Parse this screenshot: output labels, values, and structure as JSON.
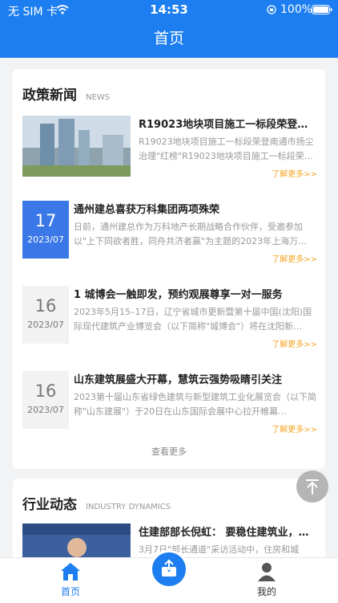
{
  "status_bar": {
    "carrier": "无 SIM 卡",
    "time": "14:53",
    "battery": "100%"
  },
  "header": {
    "title": "首页"
  },
  "policy_news": {
    "title": "政策新闻",
    "subtitle": "NEWS",
    "more_label": "了解更多>>",
    "view_more": "查看更多",
    "items": [
      {
        "title": "R19023地块项目施工一标段荣登南…",
        "desc": "R19023地块项目施工一标段荣登南通市扬尘治理\"红榜\"R19023地块项目施工一标段荣…"
      },
      {
        "day": "17",
        "month": "2023/07",
        "title": "通州建总喜获万科集团两项殊荣",
        "desc": "日前，通州建总作为万科地产长期战略合作伙伴，受邀参加以\"上下同欲者胜，同舟共济者赢\"为主题的2023年上海万…"
      },
      {
        "day": "16",
        "month": "2023/07",
        "title": "1 城博会一触即发，预约观展尊享一对一服务",
        "desc": "2023年5月15–17日，辽宁省城市更新暨第十届中国(沈阳)国际现代建筑产业博览会（以下简称\"城博会\"）将在沈阳新…"
      },
      {
        "day": "16",
        "month": "2023/07",
        "title": "山东建筑展盛大开幕，慧筑云强势吸睛引关注",
        "desc": "2023第十届山东省绿色建筑与新型建筑工业化展览会（以下简称\"山东建展\"）于20日在山东国际会展中心拉开帷幕…"
      }
    ]
  },
  "industry": {
    "title": "行业动态",
    "subtitle": "INDUSTRY DYNAMICS",
    "items": [
      {
        "title": "住建部部长倪虹： 要稳住建筑业，…",
        "desc": "3月7日\"部长通道\"采访活动中，住房和城"
      }
    ]
  },
  "tabbar": {
    "home": "首页",
    "mine": "我的"
  },
  "colors": {
    "primary": "#1c7ef0",
    "date_active": "#3a78e8",
    "more": "#f5a623"
  },
  "icons": {
    "home": "home-icon",
    "center": "upload-icon",
    "mine": "user-icon",
    "top": "back-to-top-icon"
  }
}
